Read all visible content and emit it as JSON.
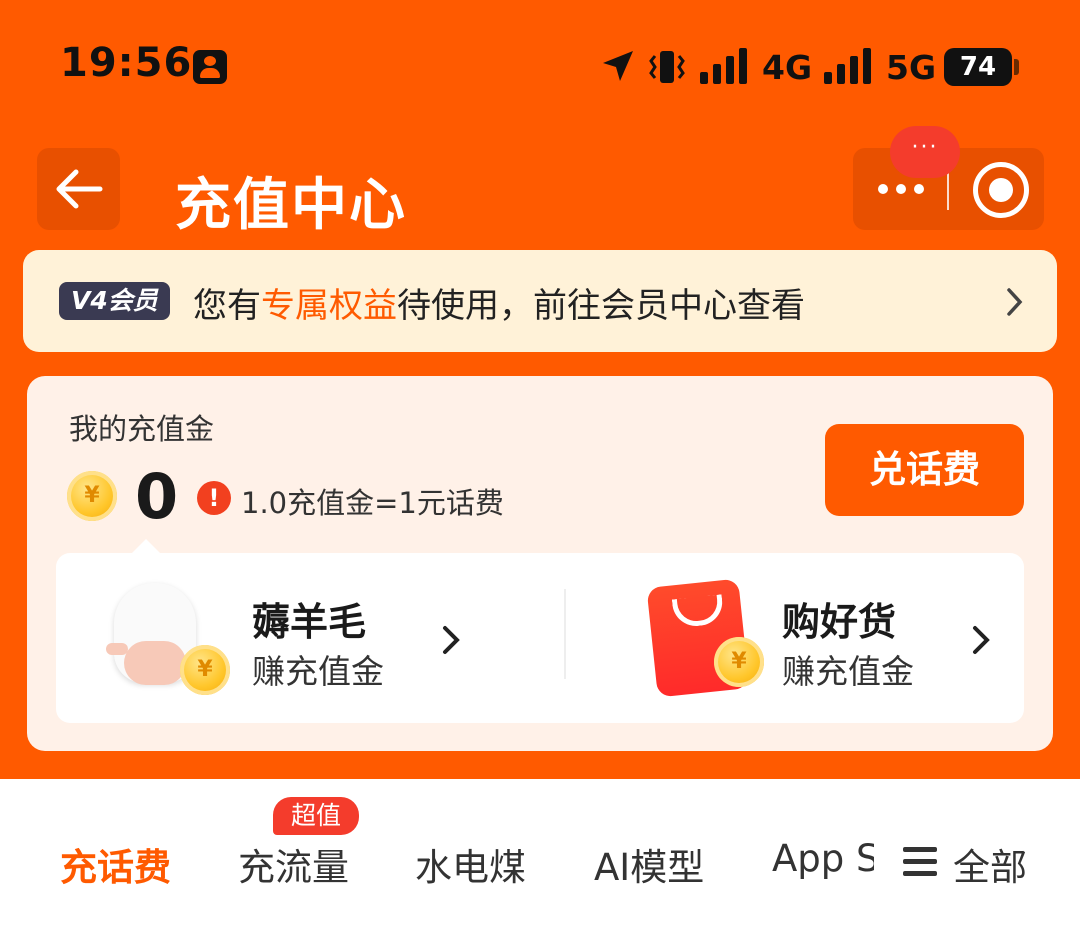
{
  "status_bar": {
    "time": "19:56",
    "network_1": "4G",
    "network_2": "5G",
    "battery": "74"
  },
  "header": {
    "title": "充值中心",
    "more_badge": "···"
  },
  "member_banner": {
    "tag": "V4会员",
    "text_before": "您有",
    "text_highlight": "专属权益",
    "text_after": "待使用，前往会员中心查看"
  },
  "balance": {
    "label": "我的充值金",
    "value": "0",
    "coin_symbol": "¥",
    "rate_note": "1.0充值金=1元话费",
    "redeem_button": "兑话费"
  },
  "earn": [
    {
      "title": "薅羊毛",
      "subtitle": "赚充值金"
    },
    {
      "title": "购好货",
      "subtitle": "赚充值金"
    }
  ],
  "tabs": {
    "items": [
      "充话费",
      "充流量",
      "水电煤",
      "AI模型"
    ],
    "overflow_item": "App Store",
    "badge": "超值",
    "all_label": "全部"
  },
  "colors": {
    "brand": "#ff5a00",
    "banner_bg": "#fff2d8",
    "badge_red": "#f43c2c"
  }
}
